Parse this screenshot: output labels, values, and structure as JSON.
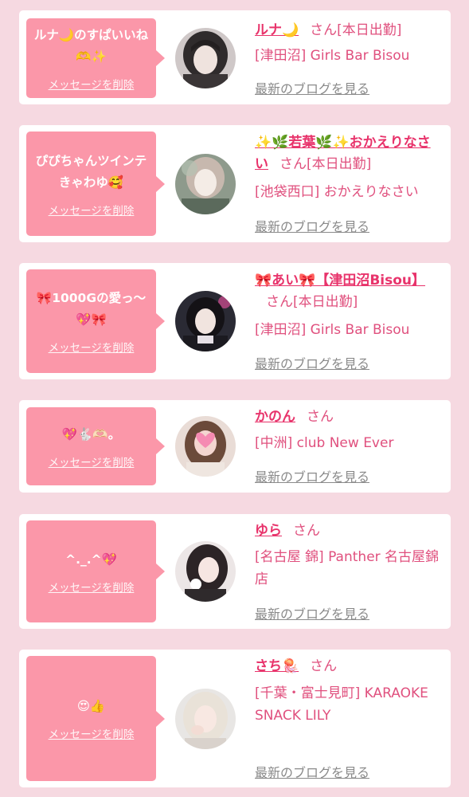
{
  "delete_label": "メッセージを削除",
  "blog_label": "最新のブログを見る",
  "san": "さん",
  "colors": {
    "background": "#f6d9e1",
    "bubble": "#fb97a9",
    "name": "#e8336b",
    "text_pink": "#e0507e",
    "link_gray": "#8a8a8a"
  },
  "items": [
    {
      "message": "ルナ🌙のすぱいいね🫶✨",
      "name": "ルナ🌙",
      "status": "[本日出勤]",
      "shop": "[津田沼] Girls Bar Bisou"
    },
    {
      "message": "ぴぴちゃんツインテきゃわゆ🥰",
      "name": "✨🌿若葉🌿✨おかえりなさい",
      "status": "[本日出勤]",
      "shop": "[池袋西口] おかえりなさい"
    },
    {
      "message": "🎀1000Gの愛っ〜💖🎀",
      "name": "🎀あい🎀【津田沼Bisou】",
      "status": "[本日出勤]",
      "shop": "[津田沼] Girls Bar Bisou"
    },
    {
      "message": "💖🐇🫶🏻。",
      "name": "かのん",
      "status": "",
      "shop": "[中洲] club New Ever"
    },
    {
      "message": "^._.^💖",
      "name": "ゆら",
      "status": "",
      "shop": "[名古屋 錦] Panther 名古屋錦店"
    },
    {
      "message": "😍👍",
      "name": "さち🪼",
      "status": "",
      "shop": "[千葉・富士見町] KARAOKE SNACK LILY"
    }
  ]
}
